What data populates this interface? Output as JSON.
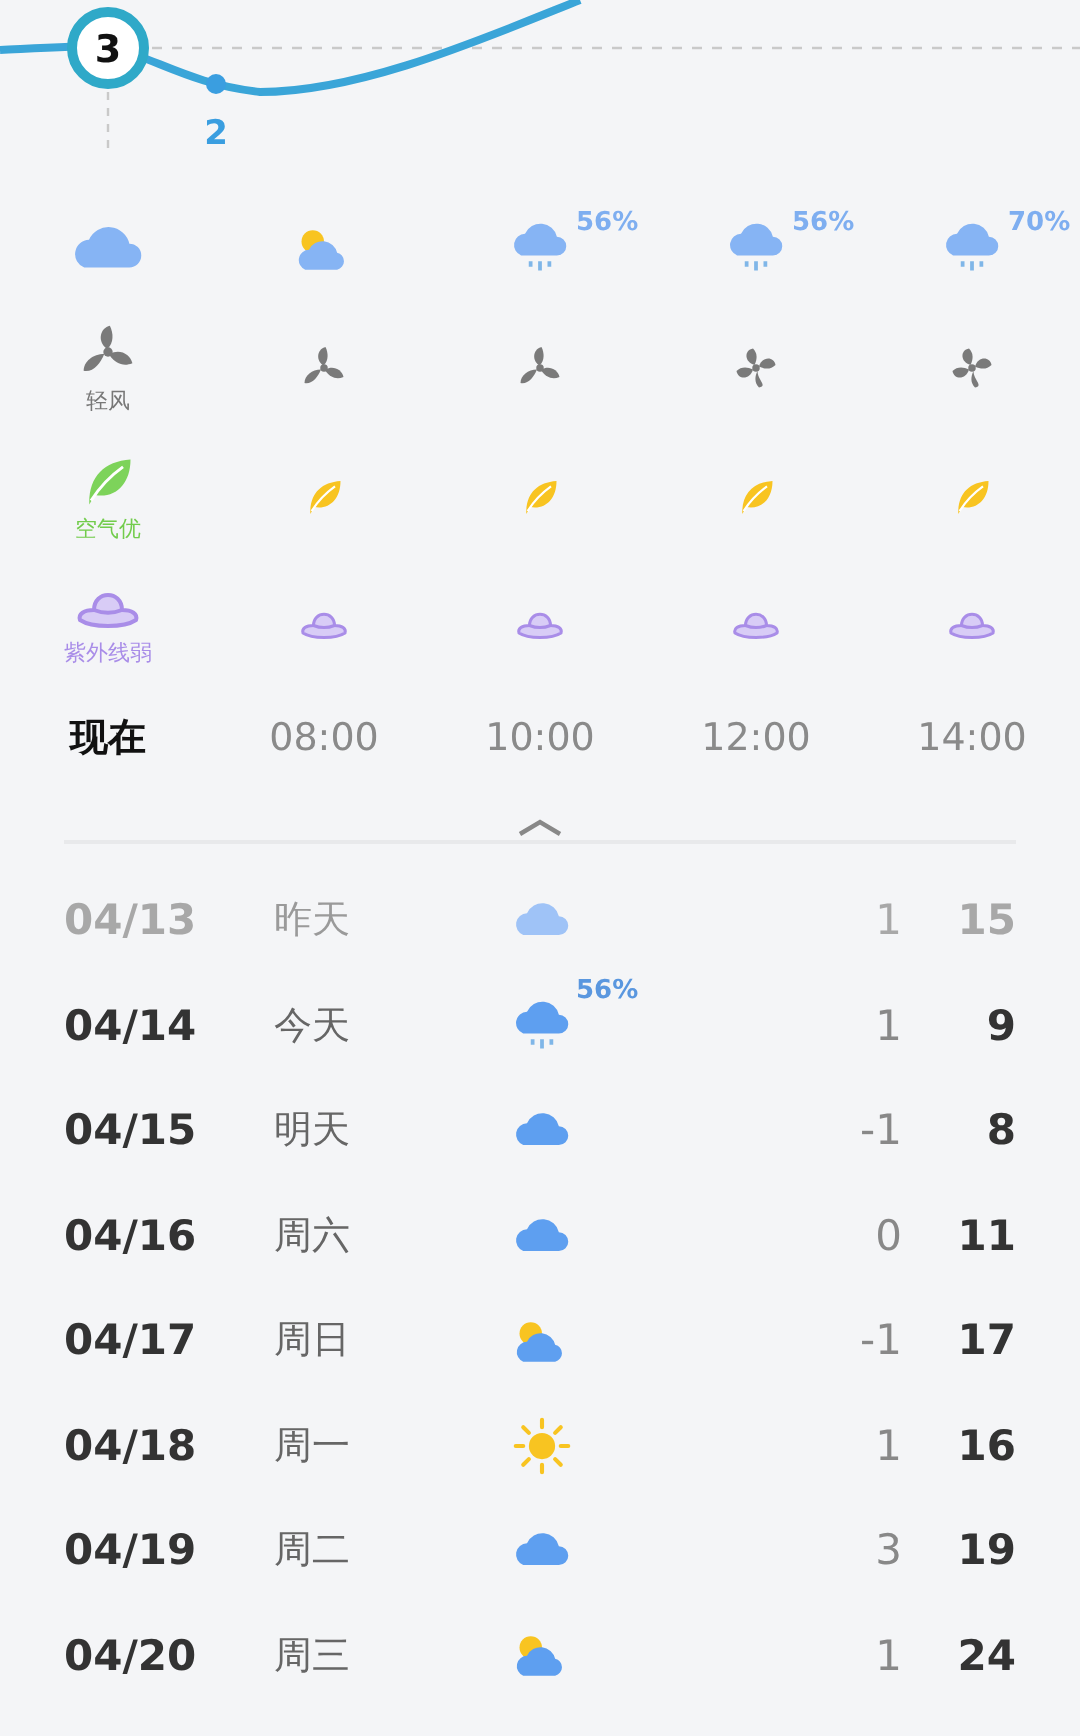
{
  "temperature_curve": {
    "current_label": "3",
    "next_label": "2"
  },
  "hours": [
    {
      "time": "现在",
      "selected": true,
      "weather": {
        "kind": "cloud"
      },
      "wind": {
        "kind": "three-blade",
        "label": "轻风"
      },
      "air": {
        "color": "#7dd35a",
        "label": "空气优"
      },
      "uv": {
        "label": "紫外线弱"
      }
    },
    {
      "time": "08:00",
      "selected": false,
      "weather": {
        "kind": "partly-cloudy"
      },
      "wind": {
        "kind": "three-blade"
      },
      "air": {
        "color": "#f8c421"
      }
    },
    {
      "time": "10:00",
      "selected": false,
      "weather": {
        "kind": "rain",
        "precip": "56%"
      },
      "wind": {
        "kind": "three-blade"
      },
      "air": {
        "color": "#f8c421"
      }
    },
    {
      "time": "12:00",
      "selected": false,
      "weather": {
        "kind": "rain",
        "precip": "56%"
      },
      "wind": {
        "kind": "four-blade"
      },
      "air": {
        "color": "#f8c421"
      }
    },
    {
      "time": "14:00",
      "selected": false,
      "weather": {
        "kind": "rain",
        "precip": "70%"
      },
      "wind": {
        "kind": "four-blade"
      },
      "air": {
        "color": "#f8c421"
      }
    }
  ],
  "days": [
    {
      "date": "04/13",
      "day": "昨天",
      "weather": {
        "kind": "cloud"
      },
      "low": "1",
      "high": "15",
      "past": true
    },
    {
      "date": "04/14",
      "day": "今天",
      "weather": {
        "kind": "rain",
        "precip": "56%"
      },
      "low": "1",
      "high": "9",
      "past": false
    },
    {
      "date": "04/15",
      "day": "明天",
      "weather": {
        "kind": "cloud"
      },
      "low": "-1",
      "high": "8",
      "past": false
    },
    {
      "date": "04/16",
      "day": "周六",
      "weather": {
        "kind": "cloud"
      },
      "low": "0",
      "high": "11",
      "past": false
    },
    {
      "date": "04/17",
      "day": "周日",
      "weather": {
        "kind": "partly-cloudy"
      },
      "low": "-1",
      "high": "17",
      "past": false
    },
    {
      "date": "04/18",
      "day": "周一",
      "weather": {
        "kind": "sunny"
      },
      "low": "1",
      "high": "16",
      "past": false
    },
    {
      "date": "04/19",
      "day": "周二",
      "weather": {
        "kind": "cloud"
      },
      "low": "3",
      "high": "19",
      "past": false
    },
    {
      "date": "04/20",
      "day": "周三",
      "weather": {
        "kind": "partly-cloudy"
      },
      "low": "1",
      "high": "24",
      "past": false
    }
  ]
}
